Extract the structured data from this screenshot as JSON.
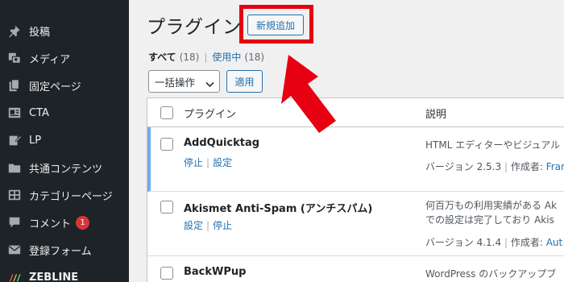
{
  "sidebar": {
    "items": [
      {
        "label": "投稿",
        "icon": "pin-icon"
      },
      {
        "label": "メディア",
        "icon": "media-icon"
      },
      {
        "label": "固定ページ",
        "icon": "pages-icon"
      },
      {
        "label": "CTA",
        "icon": "cta-icon"
      },
      {
        "label": "LP",
        "icon": "edit-icon"
      },
      {
        "label": "共通コンテンツ",
        "icon": "folder-icon"
      },
      {
        "label": "カテゴリーページ",
        "icon": "grid-icon"
      },
      {
        "label": "コメント",
        "icon": "comment-icon",
        "badge": "1"
      },
      {
        "label": "登録フォーム",
        "icon": "mail-icon"
      },
      {
        "label": "ZEBLINE",
        "icon": "zebline-icon"
      }
    ]
  },
  "header": {
    "title": "プラグイン",
    "add_new_label": "新規追加"
  },
  "filters": {
    "all_label": "すべて",
    "all_count": "(18)",
    "active_label": "使用中",
    "active_count": "(18)"
  },
  "bulk": {
    "select_value": "一括操作",
    "apply_label": "適用"
  },
  "table": {
    "col_plugin": "プラグイン",
    "col_desc": "説明",
    "rows": [
      {
        "name": "AddQuicktag",
        "actions": [
          "停止",
          "設定"
        ],
        "desc": [
          "HTML エディターやビジュアル"
        ],
        "version": "バージョン 2.5.3",
        "author_prefix": "作成者:",
        "author": "Fran"
      },
      {
        "name": "Akismet Anti-Spam (アンチスパム)",
        "actions": [
          "設定",
          "停止"
        ],
        "desc": [
          "何百万もの利用実績がある Ak",
          "での設定は完了しており Akis"
        ],
        "version": "バージョン 4.1.4",
        "author_prefix": "作成者:",
        "author": "Aut"
      },
      {
        "name": "BackWPup",
        "actions": [],
        "desc": [
          "WordPress のバックアップブ"
        ],
        "version": "",
        "author_prefix": "",
        "author": ""
      }
    ]
  },
  "colors": {
    "sidebar_bg": "#1d2327",
    "accent": "#2271b1",
    "highlight": "#e60012",
    "active_row_border": "#72aee6"
  }
}
